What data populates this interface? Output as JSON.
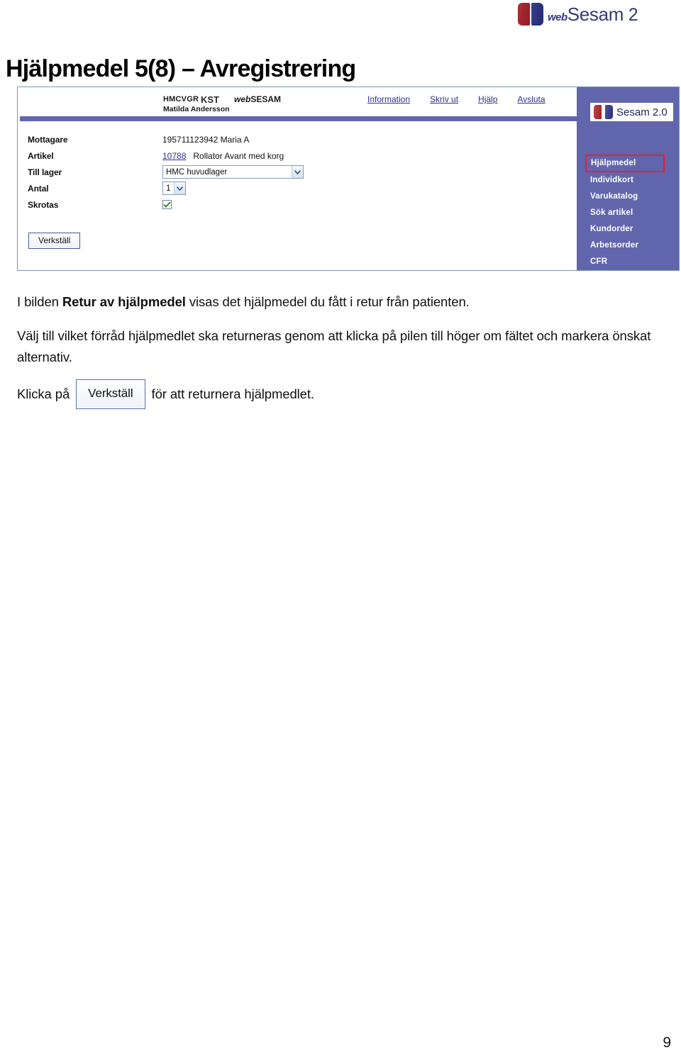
{
  "brand": {
    "web": "web",
    "sesam": "Sesam",
    "version": "2",
    "colors": {
      "red": "#a0242c",
      "blue": "#2d3480",
      "text": "#343a7a"
    }
  },
  "page_title": "Hjälpmedel 5(8) – Avregistrering",
  "page_number": "9",
  "screenshot": {
    "header": {
      "org": "HMCVGR",
      "kst": "KST",
      "app_web": "web",
      "app_name": "SESAM",
      "user": "Matilda Andersson",
      "links": [
        {
          "label": "Information"
        },
        {
          "label": "Skriv ut"
        },
        {
          "label": "Hjälp"
        },
        {
          "label": "Avsluta"
        }
      ]
    },
    "form": {
      "rows": [
        {
          "label": "Mottagare",
          "value": "195711123942 Maria A",
          "type": "text"
        },
        {
          "label": "Artikel",
          "link": "10788",
          "value": "Rollator Avant med korg",
          "type": "link-text"
        },
        {
          "label": "Till lager",
          "value": "HMC huvudlager",
          "type": "select-wide"
        },
        {
          "label": "Antal",
          "value": "1",
          "type": "select-narrow"
        },
        {
          "label": "Skrotas",
          "value": "",
          "type": "checkbox",
          "checked": true
        }
      ],
      "submit_label": "Verkställ"
    },
    "sidebar": {
      "badge_text": "Sesam 2.0",
      "background_color": "#6166ac",
      "active_outline_color": "#e8202a",
      "items": [
        {
          "label": "Hjälpmedel",
          "active": true
        },
        {
          "label": "Individkort",
          "active": false
        },
        {
          "label": "Varukatalog",
          "active": false
        },
        {
          "label": "Sök artikel",
          "active": false
        },
        {
          "label": "Kundorder",
          "active": false
        },
        {
          "label": "Arbetsorder",
          "active": false
        },
        {
          "label": "CFR",
          "active": false
        }
      ]
    }
  },
  "body": {
    "para1_a": "I bilden ",
    "para1_bold": "Retur av hjälpmedel",
    "para1_b": " visas det hjälpmedel du fått i retur från patienten.",
    "para2": "Välj till vilket förråd hjälpmedlet ska returneras genom att klicka på pilen till höger om fältet och markera önskat alternativ.",
    "para3_a": "Klicka på",
    "para3_button": "Verkställ",
    "para3_b": "för att returnera hjälpmedlet."
  }
}
